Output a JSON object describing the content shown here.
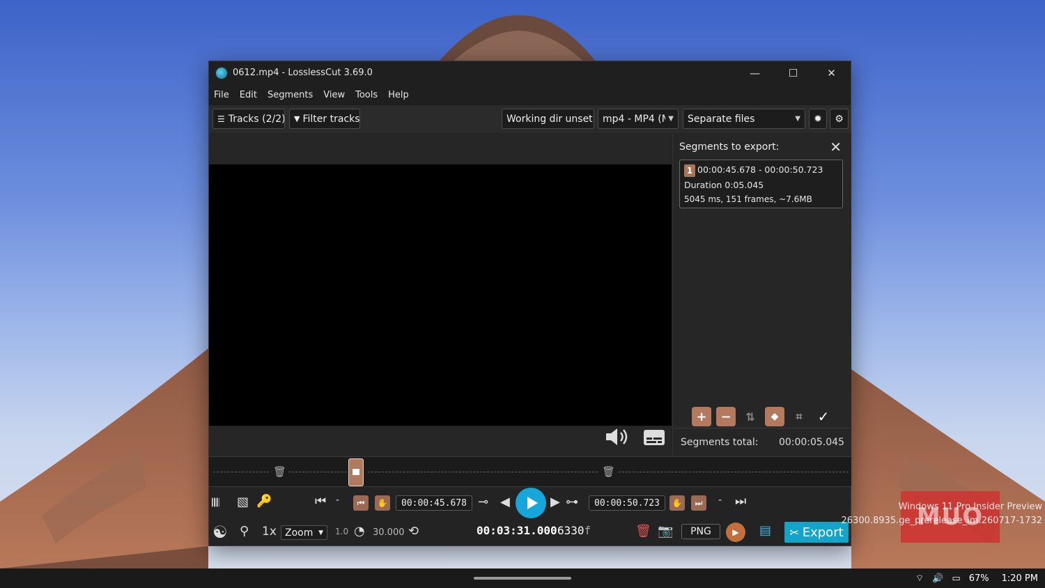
{
  "window": {
    "title": "0612.mp4 - LosslessCut 3.69.0",
    "minimize": "—",
    "maximize": "☐",
    "close": "✕"
  },
  "menu": [
    "File",
    "Edit",
    "Segments",
    "View",
    "Tools",
    "Help"
  ],
  "toolbar": {
    "tracks": "Tracks (2/2)",
    "filter_tracks": "Filter tracks",
    "working_dir": "Working dir unset",
    "format": "mp4 - MP4 (M",
    "output_mode": "Separate files"
  },
  "segments_panel": {
    "heading": "Segments to export:",
    "segment": {
      "number": "1",
      "range": "00:00:45.678 - 00:00:50.723",
      "duration": "Duration 0:05.045",
      "details": "5045 ms, 151 frames, ~7.6MB"
    },
    "total_label": "Segments total:",
    "total_value": "00:00:05.045"
  },
  "controls": {
    "start_time": "00:00:45.678",
    "end_time": "00:00:50.723",
    "dash": "-",
    "speed": "1x",
    "zoom_select": "Zoom",
    "zoom_value": "1.0",
    "fps": "30.000",
    "total_time": "00:03:31.000",
    "frames_num": "6330",
    "frames_suffix": "f",
    "snapshot_format": "PNG",
    "export": "Export"
  },
  "taskbar": {
    "battery": "67%",
    "clock": "1:20 PM"
  },
  "watermark": {
    "line1": "Windows 11 Pro Insider Preview",
    "line2": "26300.8935.ge_prerelease_im.260717-1732",
    "logo": "MUO"
  },
  "colors": {
    "accent": "#17a6d9",
    "segment": "#a97358",
    "window_bg": "#232323"
  }
}
